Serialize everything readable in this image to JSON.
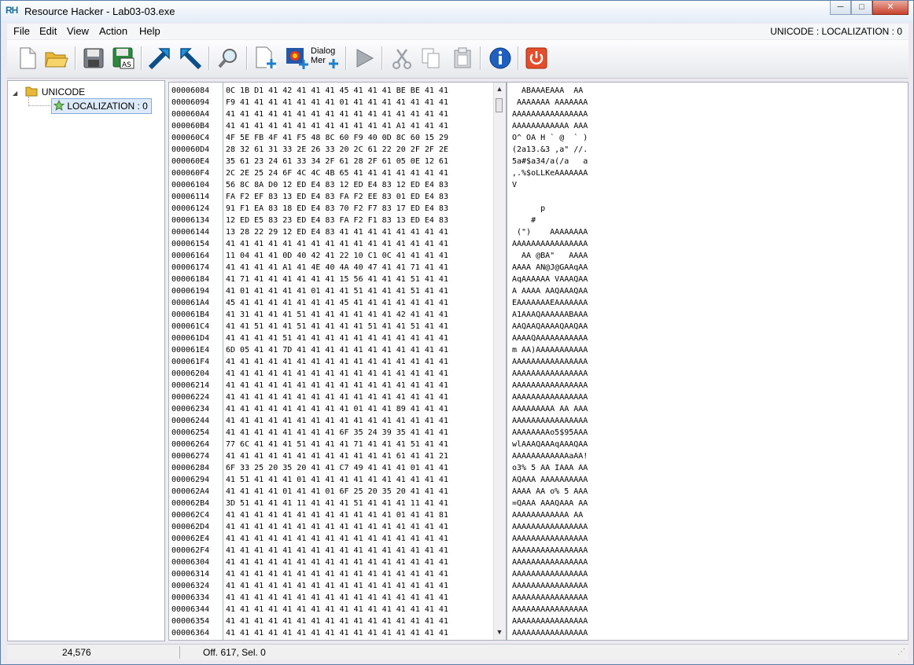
{
  "window": {
    "app_icon": "RH",
    "title": "Resource Hacker - Lab03-03.exe",
    "minimize": "─",
    "maximize": "□",
    "close": "✕"
  },
  "menu": {
    "items": [
      "File",
      "Edit",
      "View",
      "Action",
      "Help"
    ],
    "status": "UNICODE : LOCALIZATION : 0"
  },
  "toolbar": {
    "dialog_merge_label_1": "Dialog",
    "dialog_merge_label_2": "Mer",
    "icons": [
      "new-file-icon",
      "open-folder-icon",
      "save-icon",
      "save-as-icon",
      "compile-icon",
      "compile-alt-icon",
      "find-icon",
      "add-resource-icon",
      "add-image-icon",
      "dialog-merge-icon",
      "play-icon",
      "cut-icon",
      "copy-icon",
      "paste-icon",
      "info-icon",
      "power-icon"
    ]
  },
  "tree": {
    "root": "UNICODE",
    "child": "LOCALIZATION : 0",
    "expander": "◢"
  },
  "hex": {
    "addresses": [
      "00006084",
      "00006094",
      "000060A4",
      "000060B4",
      "000060C4",
      "000060D4",
      "000060E4",
      "000060F4",
      "00006104",
      "00006114",
      "00006124",
      "00006134",
      "00006144",
      "00006154",
      "00006164",
      "00006174",
      "00006184",
      "00006194",
      "000061A4",
      "000061B4",
      "000061C4",
      "000061D4",
      "000061E4",
      "000061F4",
      "00006204",
      "00006214",
      "00006224",
      "00006234",
      "00006244",
      "00006254",
      "00006264",
      "00006274",
      "00006284",
      "00006294",
      "000062A4",
      "000062B4",
      "000062C4",
      "000062D4",
      "000062E4",
      "000062F4",
      "00006304",
      "00006314",
      "00006324",
      "00006334",
      "00006344",
      "00006354",
      "00006364"
    ],
    "lines": [
      "0C 1B D1 41 42 41 41 41 45 41 41 41 BE BE 41 41",
      "F9 41 41 41 41 41 41 41 01 41 41 41 41 41 41 41",
      "41 41 41 41 41 41 41 41 41 41 41 41 41 41 41 41",
      "41 41 41 41 41 41 41 41 41 41 41 41 A1 41 41 41",
      "4F 5E FB 4F 41 F5 48 8C 60 F9 40 0D 8C 60 15 29",
      "28 32 61 31 33 2E 26 33 20 2C 61 22 20 2F 2F 2E",
      "35 61 23 24 61 33 34 2F 61 28 2F 61 05 0E 12 61",
      "2C 2E 25 24 6F 4C 4C 4B 65 41 41 41 41 41 41 41",
      "56 8C 8A D0 12 ED E4 83 12 ED E4 83 12 ED E4 83",
      "FA F2 EF 83 13 ED E4 83 FA F2 EE 83 01 ED E4 83",
      "91 F1 EA 83 18 ED E4 83 70 F2 F7 83 17 ED E4 83",
      "12 ED E5 83 23 ED E4 83 FA F2 F1 83 13 ED E4 83",
      "13 28 22 29 12 ED E4 83 41 41 41 41 41 41 41 41",
      "41 41 41 41 41 41 41 41 41 41 41 41 41 41 41 41",
      "11 04 41 41 0D 40 42 41 22 10 C1 0C 41 41 41 41",
      "41 41 41 41 A1 41 4E 40 4A 40 47 41 41 71 41 41",
      "41 71 41 41 41 41 41 41 15 56 41 41 41 51 41 41",
      "41 01 41 41 41 41 01 41 41 51 41 41 41 51 41 41",
      "45 41 41 41 41 41 41 41 45 41 41 41 41 41 41 41",
      "41 31 41 41 41 51 41 41 41 41 41 41 42 41 41 41",
      "41 41 51 41 41 51 41 41 41 41 51 41 41 51 41 41",
      "41 41 41 41 51 41 41 41 41 41 41 41 41 41 41 41",
      "6D 05 41 41 7D 41 41 41 41 41 41 41 41 41 41 41",
      "41 41 41 41 41 41 41 41 41 41 41 41 41 41 41 41",
      "41 41 41 41 41 41 41 41 41 41 41 41 41 41 41 41",
      "41 41 41 41 41 41 41 41 41 41 41 41 41 41 41 41",
      "41 41 41 41 41 41 41 41 41 41 41 41 41 41 41 41",
      "41 41 41 41 41 41 41 41 41 01 41 41 89 41 41 41",
      "41 41 41 41 41 41 41 41 41 41 41 41 41 41 41 41",
      "41 41 41 41 41 41 41 41 6F 35 24 39 35 41 41 41",
      "77 6C 41 41 41 51 41 41 41 71 41 41 41 51 41 41",
      "41 41 41 41 41 41 41 41 41 41 41 41 61 41 41 21",
      "6F 33 25 20 35 20 41 41 C7 49 41 41 41 01 41 41",
      "41 51 41 41 41 01 41 41 41 41 41 41 41 41 41 41",
      "41 41 41 41 01 41 41 01 6F 25 20 35 20 41 41 41",
      "3D 51 41 41 41 11 41 41 41 51 41 41 41 11 41 41",
      "41 41 41 41 41 41 41 41 41 41 41 41 01 41 41 81",
      "41 41 41 41 41 41 41 41 41 41 41 41 41 41 41 41",
      "41 41 41 41 41 41 41 41 41 41 41 41 41 41 41 41",
      "41 41 41 41 41 41 41 41 41 41 41 41 41 41 41 41",
      "41 41 41 41 41 41 41 41 41 41 41 41 41 41 41 41",
      "41 41 41 41 41 41 41 41 41 41 41 41 41 41 41 41",
      "41 41 41 41 41 41 41 41 41 41 41 41 41 41 41 41",
      "41 41 41 41 41 41 41 41 41 41 41 41 41 41 41 41",
      "41 41 41 41 41 41 41 41 41 41 41 41 41 41 41 41",
      "41 41 41 41 41 41 41 41 41 41 41 41 41 41 41 41",
      "41 41 41 41 41 41 41 41 41 41 41 41 41 41 41 41"
    ],
    "scroll_up": "▲",
    "scroll_down": "▼"
  },
  "ascii": {
    "lines": [
      "  ABAAAEAAA  AA",
      " AAAAAAA AAAAAAA",
      "AAAAAAAAAAAAAAAA",
      "AAAAAAAAAAAA AAA",
      "O^ OA H ` @  ` )",
      "(2a13.&3 ,a\" //.",
      "5a#$a34/a(/a   a",
      ",.%$oLLKeAAAAAAA",
      "V",
      "",
      "      p",
      "    #",
      " (\")    AAAAAAAA",
      "AAAAAAAAAAAAAAAA",
      "  AA @BA\"   AAAA",
      "AAAA AN@J@GAAqAA",
      "AqAAAAAA VAAAQAA",
      "A AAAA AAQAAAQAA",
      "EAAAAAAAEAAAAAAA",
      "A1AAAQAAAAAABAAA",
      "AAQAAQAAAAQAAQAA",
      "AAAAQAAAAAAAAAAA",
      "m AA)AAAAAAAAAAA",
      "AAAAAAAAAAAAAAAA",
      "AAAAAAAAAAAAAAAA",
      "AAAAAAAAAAAAAAAA",
      "AAAAAAAAAAAAAAAA",
      "AAAAAAAAA AA AAA",
      "AAAAAAAAAAAAAAAA",
      "AAAAAAAAo5$95AAA",
      "wlAAAQAAAqAAAQAA",
      "AAAAAAAAAAAAaAA!",
      "o3% 5 AA IAAA AA",
      "AQAAA AAAAAAAAAA",
      "AAAA AA o% 5 AAA",
      "=QAAA AAAQAAA AA",
      "AAAAAAAAAAAA AA",
      "AAAAAAAAAAAAAAAA",
      "AAAAAAAAAAAAAAAA",
      "AAAAAAAAAAAAAAAA",
      "AAAAAAAAAAAAAAAA",
      "AAAAAAAAAAAAAAAA",
      "AAAAAAAAAAAAAAAA",
      "AAAAAAAAAAAAAAAA",
      "AAAAAAAAAAAAAAAA",
      "AAAAAAAAAAAAAAAA",
      "AAAAAAAAAAAAAAAA"
    ]
  },
  "status": {
    "size": "24,576",
    "offset": "Off. 617, Sel. 0",
    "grip": "⋰"
  }
}
